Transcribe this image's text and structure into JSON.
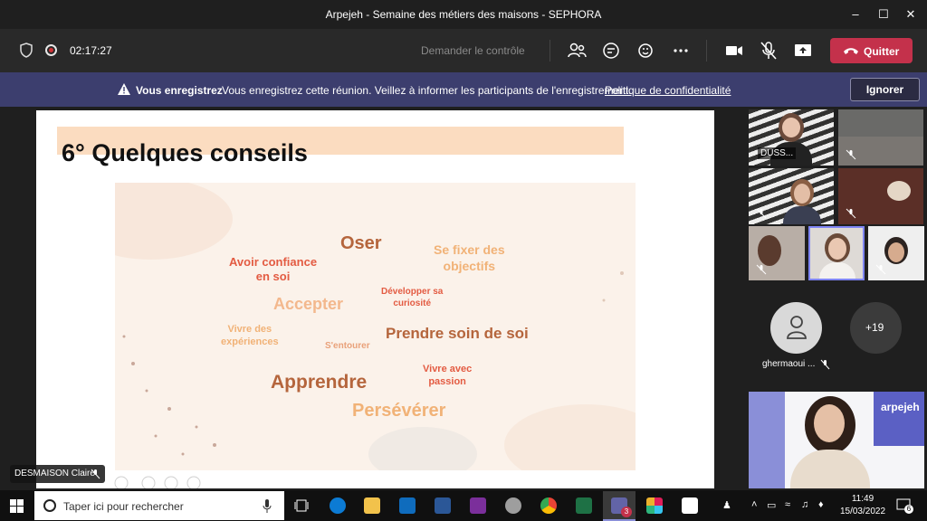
{
  "window": {
    "title": "Arpejeh - Semaine des métiers des maisons - SEPHORA"
  },
  "meeting": {
    "elapsed": "02:17:27",
    "request_control": "Demander le contrôle",
    "leave_label": "Quitter"
  },
  "recording_banner": {
    "title": "Vous enregistrez",
    "message": "Vous enregistrez cette réunion. Veillez à informer les participants de l'enregistrement.",
    "policy_link": "Politique de confidentialité",
    "ignore_label": "Ignorer"
  },
  "slide": {
    "title": "6° Quelques conseils",
    "words": [
      {
        "text": "Oser",
        "color": "#b5653c"
      },
      {
        "text": "Se fixer des\nobjectifs",
        "color": "#f1b277"
      },
      {
        "text": "Avoir confiance\nen soi",
        "color": "#e35b42"
      },
      {
        "text": "Accepter",
        "color": "#f3b88d"
      },
      {
        "text": "Développer sa\ncuriosité",
        "color": "#e35b42"
      },
      {
        "text": "Vivre des\nexpériences",
        "color": "#f1b277"
      },
      {
        "text": "S'entourer",
        "color": "#e9a17a"
      },
      {
        "text": "Prendre soin de soi",
        "color": "#b5653c"
      },
      {
        "text": "Apprendre",
        "color": "#b5653c"
      },
      {
        "text": "Vivre avec\npassion",
        "color": "#e35b42"
      },
      {
        "text": "Persévérer",
        "color": "#f1b277"
      }
    ]
  },
  "presenter": {
    "name": "DESMAISON Claire"
  },
  "participants": {
    "tile_label": "DUSS...",
    "named_participant": "ghermaoui ...",
    "overflow_count": "+19",
    "bottom_video_text": "arpejeh"
  },
  "taskbar": {
    "search_placeholder": "Taper ici pour rechercher",
    "teams_badge": "3",
    "time": "11:49",
    "date": "15/03/2022",
    "notifications": "6"
  },
  "colors": {
    "leave": "#c4314b",
    "banner": "#3c3e6e",
    "accent_teams": "#6264a7"
  }
}
